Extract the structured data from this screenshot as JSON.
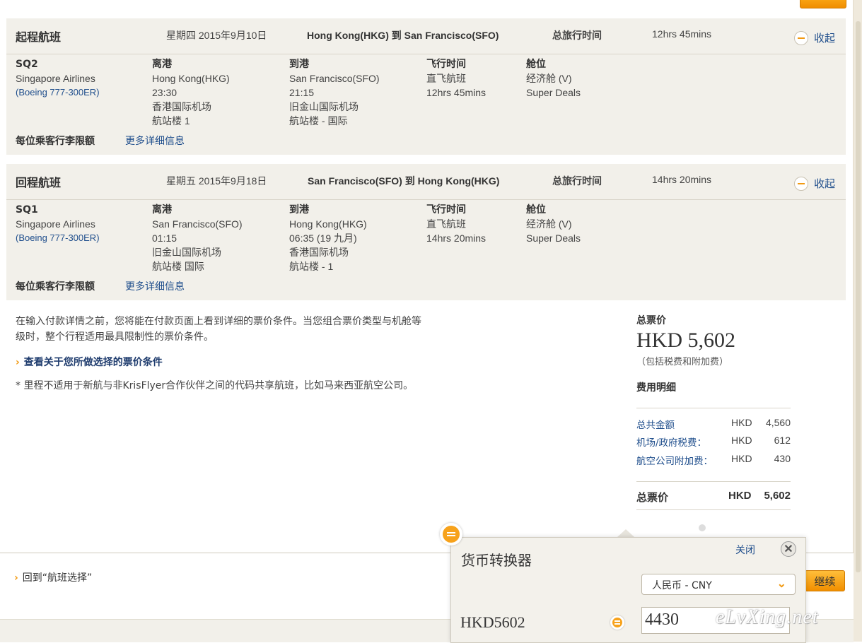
{
  "outbound": {
    "title": "起程航班",
    "date": "星期四 2015年9月10日",
    "route": "Hong Kong(HKG) 到 San Francisco(SFO)",
    "total_time_label": "总旅行时间",
    "total_time": "12hrs 45mins",
    "collapse_label": "收起",
    "flight_no": "SQ2",
    "airline": "Singapore Airlines",
    "aircraft": "(Boeing 777-300ER)",
    "depart_label": "离港",
    "depart_city": "Hong Kong(HKG)",
    "depart_time": "23:30",
    "depart_airport": "香港国际机场",
    "depart_terminal": "航站楼 1",
    "arrive_label": "到港",
    "arrive_city": "San Francisco(SFO)",
    "arrive_time": "21:15",
    "arrive_airport": "旧金山国际机场",
    "arrive_terminal": "航站楼 - 国际",
    "duration_label": "飞行时间",
    "flight_type": "直飞航班",
    "duration": "12hrs 45mins",
    "cabin_label": "舱位",
    "cabin": "经济舱 (V)",
    "fare_family": "Super Deals",
    "baggage_label": "每位乘客行李限额",
    "more_info": "更多详细信息"
  },
  "inbound": {
    "title": "回程航班",
    "date": "星期五 2015年9月18日",
    "route": "San Francisco(SFO) 到 Hong Kong(HKG)",
    "total_time_label": "总旅行时间",
    "total_time": "14hrs 20mins",
    "collapse_label": "收起",
    "flight_no": "SQ1",
    "airline": "Singapore Airlines",
    "aircraft": "(Boeing 777-300ER)",
    "depart_label": "离港",
    "depart_city": "San Francisco(SFO)",
    "depart_time": "01:15",
    "depart_airport": "旧金山国际机场",
    "depart_terminal": "航站楼 国际",
    "arrive_label": "到港",
    "arrive_city": "Hong Kong(HKG)",
    "arrive_time": "06:35 (19 九月)",
    "arrive_airport": "香港国际机场",
    "arrive_terminal": "航站楼 - 1",
    "duration_label": "飞行时间",
    "flight_type": "直飞航班",
    "duration": "14hrs 20mins",
    "cabin_label": "舱位",
    "cabin": "经济舱 (V)",
    "fare_family": "Super Deals",
    "baggage_label": "每位乘客行李限额",
    "more_info": "更多详细信息"
  },
  "notes": {
    "fare_info": "在输入付款详情之前，您将能在付款页面上看到详细的票价条件。当您组合票价类型与机舱等级时，整个行程适用最具限制性的票价条件。",
    "fare_link": "查看关于您所做选择的票价条件",
    "miles_note": "* 里程不适用于新航与非KrisFlyer合作伙伴之间的代码共享航班，比如马来西亚航空公司。"
  },
  "price": {
    "total_label": "总票价",
    "total": "HKD  5,602",
    "total_note": "（包括税费和附加费）",
    "breakdown_title": "费用明细",
    "rows": [
      {
        "name": "总共金额",
        "currency": "HKD",
        "value": "4,560"
      },
      {
        "name": "机场/政府税费：",
        "currency": "HKD",
        "value": "612"
      },
      {
        "name": "航空公司附加费：",
        "currency": "HKD",
        "value": "430"
      }
    ],
    "final_label": "总票价",
    "final_currency": "HKD",
    "final_value": "5,602"
  },
  "footer": {
    "back_link": "回到“航班选择”",
    "continue": "继续"
  },
  "converter": {
    "title": "货币转换器",
    "close_label": "关闭",
    "close_x": "✕",
    "currency_select": "人民币 - CNY",
    "amount": "HKD5602",
    "converted_value": "4430"
  },
  "watermark": "eLvXing.net",
  "colors": {
    "panel_bg": "#f2f0ea",
    "link": "#1f4e8c",
    "accent_orange": "#f29a12"
  }
}
